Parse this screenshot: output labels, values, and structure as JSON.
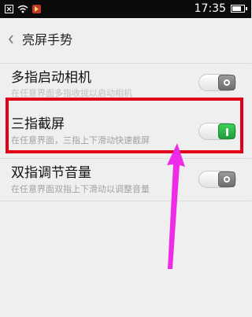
{
  "status_bar": {
    "time": "17:35",
    "icons": [
      "close-box-icon",
      "wifi-icon",
      "notification-icon"
    ]
  },
  "header": {
    "back_icon": "chevron-left-icon",
    "title": "亮屏手势"
  },
  "settings": [
    {
      "title": "多指启动相机",
      "subtitle": "在任意界面多指收拢以启动相机",
      "enabled": false
    },
    {
      "title": "三指截屏",
      "subtitle": "在任意界面，三指上下滑动快速截屏",
      "enabled": true
    },
    {
      "title": "双指调节音量",
      "subtitle": "在任意界面双指上下滑动以调整音量",
      "enabled": false
    }
  ],
  "annotation": {
    "highlight_color": "#e10017",
    "arrow_color": "#ee2be6"
  }
}
